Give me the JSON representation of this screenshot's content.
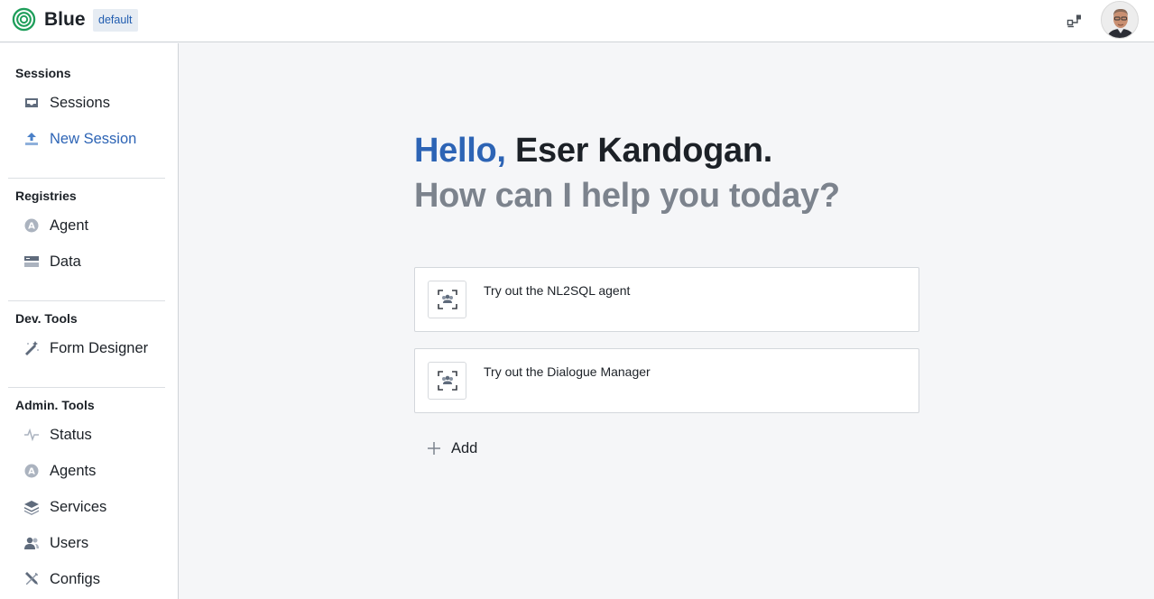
{
  "header": {
    "brand": "Blue",
    "environment": "default",
    "logo_icon": "concentric-rings-logo",
    "right_icon": "workspace-switch-icon",
    "avatar": "user-avatar"
  },
  "sidebar": {
    "sections": [
      {
        "title": "Sessions",
        "items": [
          {
            "label": "Sessions",
            "icon": "inbox-icon"
          },
          {
            "label": "New Session",
            "icon": "upload-icon",
            "active": true
          }
        ]
      },
      {
        "title": "Registries",
        "items": [
          {
            "label": "Agent",
            "icon": "agent-circle-icon"
          },
          {
            "label": "Data",
            "icon": "database-icon"
          }
        ]
      },
      {
        "title": "Dev. Tools",
        "items": [
          {
            "label": "Form Designer",
            "icon": "magic-wand-icon"
          }
        ]
      },
      {
        "title": "Admin. Tools",
        "items": [
          {
            "label": "Status",
            "icon": "pulse-icon"
          },
          {
            "label": "Agents",
            "icon": "agent-circle-icon"
          },
          {
            "label": "Services",
            "icon": "layers-icon"
          },
          {
            "label": "Users",
            "icon": "people-icon"
          },
          {
            "label": "Configs",
            "icon": "wrench-screwdriver-icon"
          }
        ]
      }
    ]
  },
  "main": {
    "greeting_hello": "Hello,",
    "greeting_name": "Eser Kandogan.",
    "greeting_question": "How can I help you today?",
    "cards": [
      {
        "label": "Try out the NL2SQL agent",
        "icon": "group-scan-icon"
      },
      {
        "label": "Try out the Dialogue Manager",
        "icon": "group-scan-icon"
      }
    ],
    "add_label": "Add"
  },
  "colors": {
    "accent": "#2d64b5",
    "muted_heading": "#7c838d",
    "background": "#f5f6f8"
  }
}
